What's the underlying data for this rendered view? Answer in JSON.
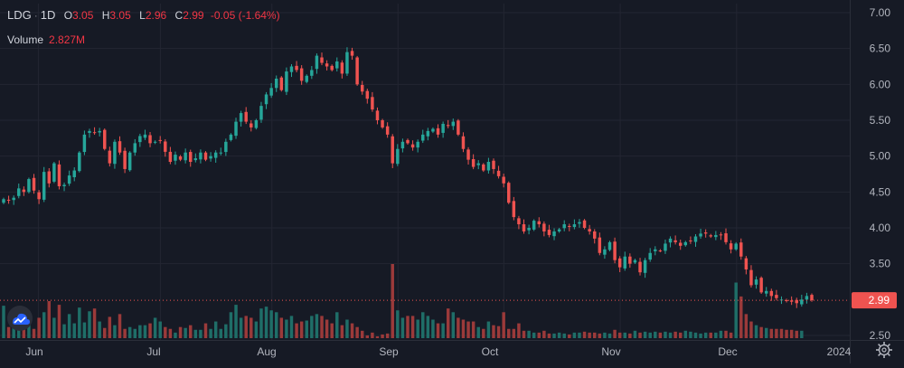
{
  "legend": {
    "symbol": "LDG",
    "interval": "1D",
    "o_label": "O",
    "o": "3.05",
    "h_label": "H",
    "h": "3.05",
    "l_label": "L",
    "l": "2.96",
    "c_label": "C",
    "c": "2.99",
    "change": "-0.05 (-1.64%)"
  },
  "volume_legend": {
    "label": "Volume",
    "value": "2.827M"
  },
  "icons": {
    "logo": "tradingview-cloud-icon",
    "settings": "gear-icon"
  },
  "colors": {
    "background": "#161a25",
    "up": "#26a69a",
    "down": "#ef5350",
    "up_volume": "#1f6e68",
    "down_volume": "#9b3a3a",
    "grid": "#232632",
    "axis_text": "#b2b5be",
    "price_tag": "#ef5350"
  },
  "chart_data": {
    "type": "candlestick",
    "ylim": [
      2.45,
      7.05
    ],
    "yticks": [
      "7.00",
      "6.50",
      "6.00",
      "5.50",
      "5.00",
      "4.50",
      "4.00",
      "3.50",
      "2.50"
    ],
    "xticks": [
      "Jun",
      "Jul",
      "Aug",
      "Sep",
      "Oct",
      "Nov",
      "Dec",
      "2024"
    ],
    "last_price": "2.99",
    "grid": true,
    "series": [
      {
        "name": "price",
        "close": [
          4.4,
          4.38,
          4.42,
          4.55,
          4.5,
          4.68,
          4.52,
          4.4,
          4.78,
          4.62,
          4.9,
          4.58,
          4.6,
          4.73,
          4.8,
          5.05,
          5.3,
          5.35,
          5.33,
          5.35,
          5.1,
          4.9,
          5.2,
          5.05,
          4.82,
          5.05,
          5.18,
          5.28,
          5.3,
          5.18,
          5.2,
          5.22,
          5.06,
          4.92,
          5.02,
          4.95,
          5.05,
          4.92,
          4.97,
          5.05,
          4.95,
          5.0,
          5.05,
          5.05,
          5.2,
          5.3,
          5.48,
          5.6,
          5.48,
          5.4,
          5.5,
          5.7,
          5.86,
          5.95,
          6.08,
          5.92,
          6.18,
          6.25,
          6.2,
          6.05,
          6.12,
          6.2,
          6.4,
          6.3,
          6.25,
          6.2,
          6.32,
          6.15,
          6.45,
          6.4,
          6.0,
          5.9,
          5.8,
          5.65,
          5.5,
          5.4,
          5.3,
          4.9,
          5.1,
          5.2,
          5.18,
          5.12,
          5.2,
          5.3,
          5.35,
          5.38,
          5.3,
          5.45,
          5.42,
          5.48,
          5.3,
          5.1,
          4.95,
          4.85,
          4.9,
          4.8,
          4.92,
          4.82,
          4.72,
          4.62,
          4.35,
          4.15,
          4.05,
          3.95,
          4.0,
          4.1,
          4.05,
          3.95,
          3.9,
          3.95,
          3.98,
          4.05,
          4.02,
          4.05,
          4.08,
          4.0,
          3.95,
          3.85,
          3.65,
          3.7,
          3.8,
          3.55,
          3.45,
          3.6,
          3.5,
          3.55,
          3.38,
          3.55,
          3.65,
          3.7,
          3.68,
          3.78,
          3.85,
          3.8,
          3.75,
          3.8,
          3.82,
          3.88,
          3.92,
          3.92,
          3.88,
          3.9,
          3.9,
          3.8,
          3.7,
          3.78,
          3.6,
          3.42,
          3.2,
          3.28,
          3.1,
          3.12,
          3.05,
          3.02,
          3.0,
          2.98,
          2.97,
          2.95,
          3.0,
          3.05,
          2.99
        ]
      }
    ],
    "volume_millions": [
      3.5,
      1.2,
      1.2,
      1.1,
      1.6,
      1.6,
      1.0,
      2.2,
      2.8,
      4.0,
      2.2,
      3.6,
      1.5,
      2.6,
      1.6,
      3.3,
      1.7,
      2.9,
      3.2,
      1.8,
      1.1,
      2.3,
      1.4,
      2.6,
      1.0,
      1.2,
      1.0,
      1.4,
      1.4,
      1.6,
      2.2,
      1.8,
      1.2,
      1.0,
      0.6,
      1.2,
      1.1,
      1.4,
      0.9,
      0.9,
      1.6,
      1.0,
      1.8,
      1.0,
      1.5,
      2.8,
      3.6,
      2.2,
      2.4,
      2.2,
      1.8,
      3.2,
      3.4,
      3.0,
      2.8,
      2.2,
      2.0,
      2.4,
      1.6,
      1.8,
      1.9,
      2.4,
      2.6,
      2.4,
      2.0,
      1.6,
      2.8,
      1.4,
      2.0,
      1.6,
      1.2,
      0.8,
      0.3,
      0.6,
      0.2,
      0.4,
      0.5,
      8.0,
      3.0,
      2.2,
      2.4,
      2.4,
      2.0,
      2.8,
      2.4,
      2.0,
      1.6,
      1.6,
      3.2,
      2.8,
      2.2,
      2.0,
      1.8,
      1.8,
      1.2,
      1.0,
      1.8,
      1.4,
      1.3,
      2.8,
      1.0,
      1.0,
      1.6,
      0.8,
      0.8,
      0.6,
      0.6,
      0.8,
      0.5,
      0.5,
      0.6,
      0.5,
      0.4,
      0.6,
      0.6,
      0.7,
      0.6,
      0.6,
      0.5,
      0.6,
      0.5,
      0.9,
      0.6,
      0.6,
      0.5,
      0.8,
      0.6,
      0.7,
      0.6,
      0.7,
      0.6,
      0.7,
      0.6,
      0.7,
      0.6,
      0.8,
      0.7,
      0.6,
      0.5,
      0.6,
      0.6,
      0.6,
      0.8,
      0.8,
      0.6,
      6.0,
      4.5,
      2.6,
      1.8,
      1.4,
      1.2,
      1.1,
      1.0,
      1.0,
      1.0,
      0.9,
      0.9,
      0.8,
      0.8
    ]
  }
}
